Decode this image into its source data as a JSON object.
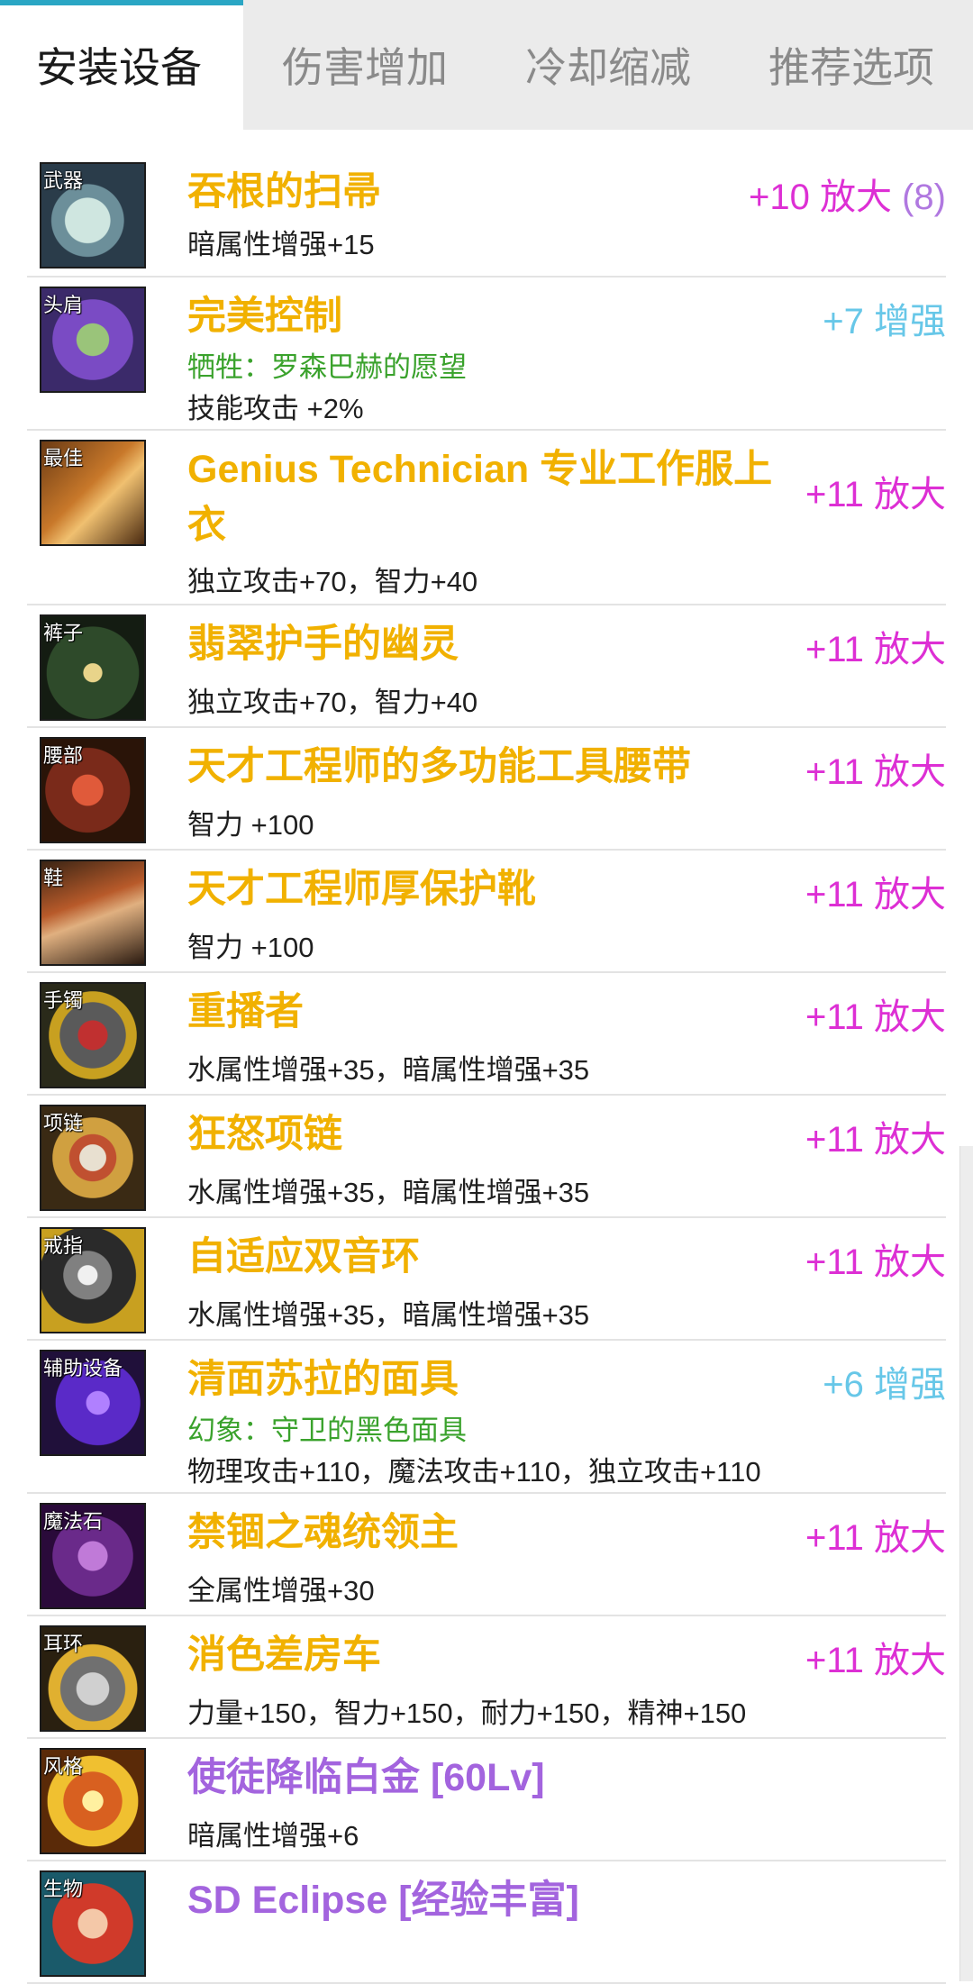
{
  "tabs": [
    {
      "label": "安装设备",
      "active": true
    },
    {
      "label": "伤害增加",
      "active": false
    },
    {
      "label": "冷却缩减",
      "active": false
    },
    {
      "label": "推荐选项",
      "active": false
    }
  ],
  "colors": {
    "accent": "#2aa6c4",
    "item_name": "#f1b100",
    "item_name_purple": "#a364de",
    "amplify": "#dd2fd4",
    "reinforce": "#67c7e8",
    "green_line": "#3aa22c"
  },
  "items": [
    {
      "slot": "武器",
      "name": "吞根的扫帚",
      "upgrade": "+10 放大",
      "upgrade_extra": "(8)",
      "upgrade_color": "magenta",
      "green": "",
      "desc": "暗属性增强+15",
      "icon": "broom-weapon-icon"
    },
    {
      "slot": "头肩",
      "name": "完美控制",
      "upgrade": "+7 增强",
      "upgrade_color": "cyan",
      "green": "牺牲：罗森巴赫的愿望",
      "desc": "技能攻击 +2%",
      "icon": "shoulder-armor-icon"
    },
    {
      "slot": "最佳",
      "name": "Genius Technician 专业工作服上衣",
      "upgrade": "+11 放大",
      "upgrade_color": "magenta",
      "green": "",
      "desc": "独立攻击+70，智力+40",
      "icon": "top-armor-icon"
    },
    {
      "slot": "裤子",
      "name": "翡翠护手的幽灵",
      "upgrade": "+11 放大",
      "upgrade_color": "magenta",
      "green": "",
      "desc": "独立攻击+70，智力+40",
      "icon": "pants-armor-icon"
    },
    {
      "slot": "腰部",
      "name": "天才工程师的多功能工具腰带",
      "upgrade": "+11 放大",
      "upgrade_color": "magenta",
      "green": "",
      "desc": "智力 +100",
      "icon": "belt-armor-icon"
    },
    {
      "slot": "鞋",
      "name": "天才工程师厚保护靴",
      "upgrade": "+11 放大",
      "upgrade_color": "magenta",
      "green": "",
      "desc": "智力 +100",
      "icon": "boots-armor-icon"
    },
    {
      "slot": "手镯",
      "name": "重播者",
      "upgrade": "+11 放大",
      "upgrade_color": "magenta",
      "green": "",
      "desc": "水属性增强+35，暗属性增强+35",
      "icon": "bracelet-icon"
    },
    {
      "slot": "项链",
      "name": "狂怒项链",
      "upgrade": "+11 放大",
      "upgrade_color": "magenta",
      "green": "",
      "desc": "水属性增强+35，暗属性增强+35",
      "icon": "necklace-icon"
    },
    {
      "slot": "戒指",
      "name": "自适应双音环",
      "upgrade": "+11 放大",
      "upgrade_color": "magenta",
      "green": "",
      "desc": "水属性增强+35，暗属性增强+35",
      "icon": "ring-icon"
    },
    {
      "slot": "辅助设备",
      "name": "清面苏拉的面具",
      "upgrade": "+6 增强",
      "upgrade_color": "cyan",
      "green": "幻象：守卫的黑色面具",
      "desc": "物理攻击+110，魔法攻击+110，独立攻击+110",
      "icon": "mask-subequip-icon"
    },
    {
      "slot": "魔法石",
      "name": "禁锢之魂统领主",
      "upgrade": "+11 放大",
      "upgrade_color": "magenta",
      "green": "",
      "desc": "全属性增强+30",
      "icon": "magic-stone-icon"
    },
    {
      "slot": "耳环",
      "name": "消色差房车",
      "upgrade": "+11 放大",
      "upgrade_color": "magenta",
      "green": "",
      "desc": "力量+150，智力+150，耐力+150，精神+150",
      "icon": "earring-icon"
    },
    {
      "slot": "风格",
      "name": "使徒降临白金 [60Lv]",
      "upgrade": "",
      "upgrade_color": "magenta",
      "green": "",
      "desc": "暗属性增强+6",
      "icon": "platinum-emblem-icon",
      "name_color": "purple"
    },
    {
      "slot": "生物",
      "name": "SD Eclipse [经验丰富]",
      "upgrade": "",
      "upgrade_color": "magenta",
      "green": "",
      "desc": "",
      "icon": "creature-pet-icon",
      "name_color": "purple"
    }
  ]
}
